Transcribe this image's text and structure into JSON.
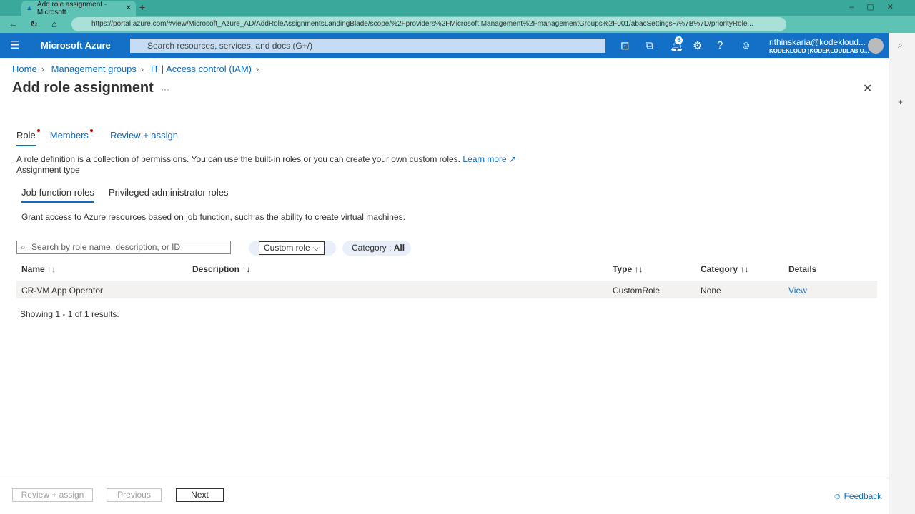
{
  "browser": {
    "tab_title": "Add role assignment - Microsoft",
    "url": "https://portal.azure.com/#view/Microsoft_Azure_AD/AddRoleAssignmentsLandingBlade/scope/%2Fproviders%2FMicrosoft.Management%2FmanagementGroups%2F001/abacSettings~/%7B%7D/priorityRole..."
  },
  "portal": {
    "brand": "Microsoft Azure",
    "search_placeholder": "Search resources, services, and docs (G+/)",
    "notification_count": "6",
    "user_email": "rithinskaria@kodekloud...",
    "user_tenant": "KODEKLOUD (KODEKLOUDLAB.O..."
  },
  "breadcrumb": [
    "Home",
    "Management groups",
    "IT | Access control (IAM)"
  ],
  "page": {
    "title": "Add role assignment",
    "more": "···"
  },
  "steps": [
    "Role",
    "Members",
    "Review + assign"
  ],
  "intro": "A role definition is a collection of permissions. You can use the built-in roles or you can create your own custom roles.",
  "learn_more": "Learn more",
  "assignment_type": "Assignment type",
  "subtabs": [
    "Job function roles",
    "Privileged administrator roles"
  ],
  "subtab_desc": "Grant access to Azure resources based on job function, such as the ability to create virtual machines.",
  "filters": {
    "search_placeholder": "Search by role name, description, or ID",
    "type_selected": "Custom role",
    "category_label": "Category : ",
    "category_value": "All"
  },
  "table": {
    "headers": [
      "Name",
      "Description",
      "Type",
      "Category",
      "Details"
    ],
    "rows": [
      {
        "name": "CR-VM App Operator",
        "description": "",
        "type": "CustomRole",
        "category": "None",
        "details": "View"
      }
    ],
    "summary": "Showing 1 - 1 of 1 results."
  },
  "footer": {
    "review": "Review + assign",
    "previous": "Previous",
    "next": "Next",
    "feedback": "Feedback"
  }
}
